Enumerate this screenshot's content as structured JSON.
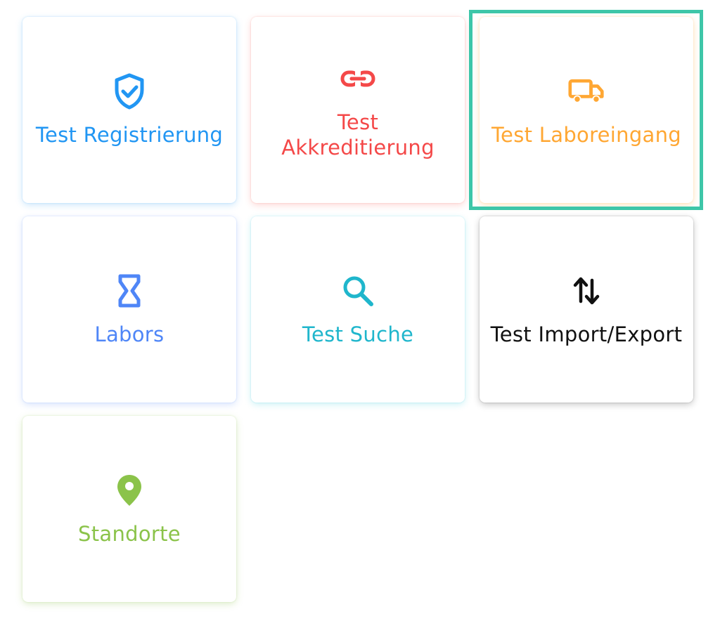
{
  "tiles": [
    {
      "label": "Test Registrierung",
      "icon": "shield-check-icon",
      "color": "#2196f3"
    },
    {
      "label": "Test Akkreditierung",
      "icon": "link-icon",
      "color": "#f44848"
    },
    {
      "label": "Test Laboreingang",
      "icon": "truck-icon",
      "color": "#ffa733",
      "focused": true
    },
    {
      "label": "Labors",
      "icon": "hourglass-icon",
      "color": "#4f86f7"
    },
    {
      "label": "Test Suche",
      "icon": "search-icon",
      "color": "#1fb6cc"
    },
    {
      "label": "Test Import/Export",
      "icon": "swap-vertical-icon",
      "color": "#111111"
    },
    {
      "label": "Standorte",
      "icon": "location-pin-icon",
      "color": "#8bc34a"
    }
  ],
  "focus_color": "#3ec6a8"
}
